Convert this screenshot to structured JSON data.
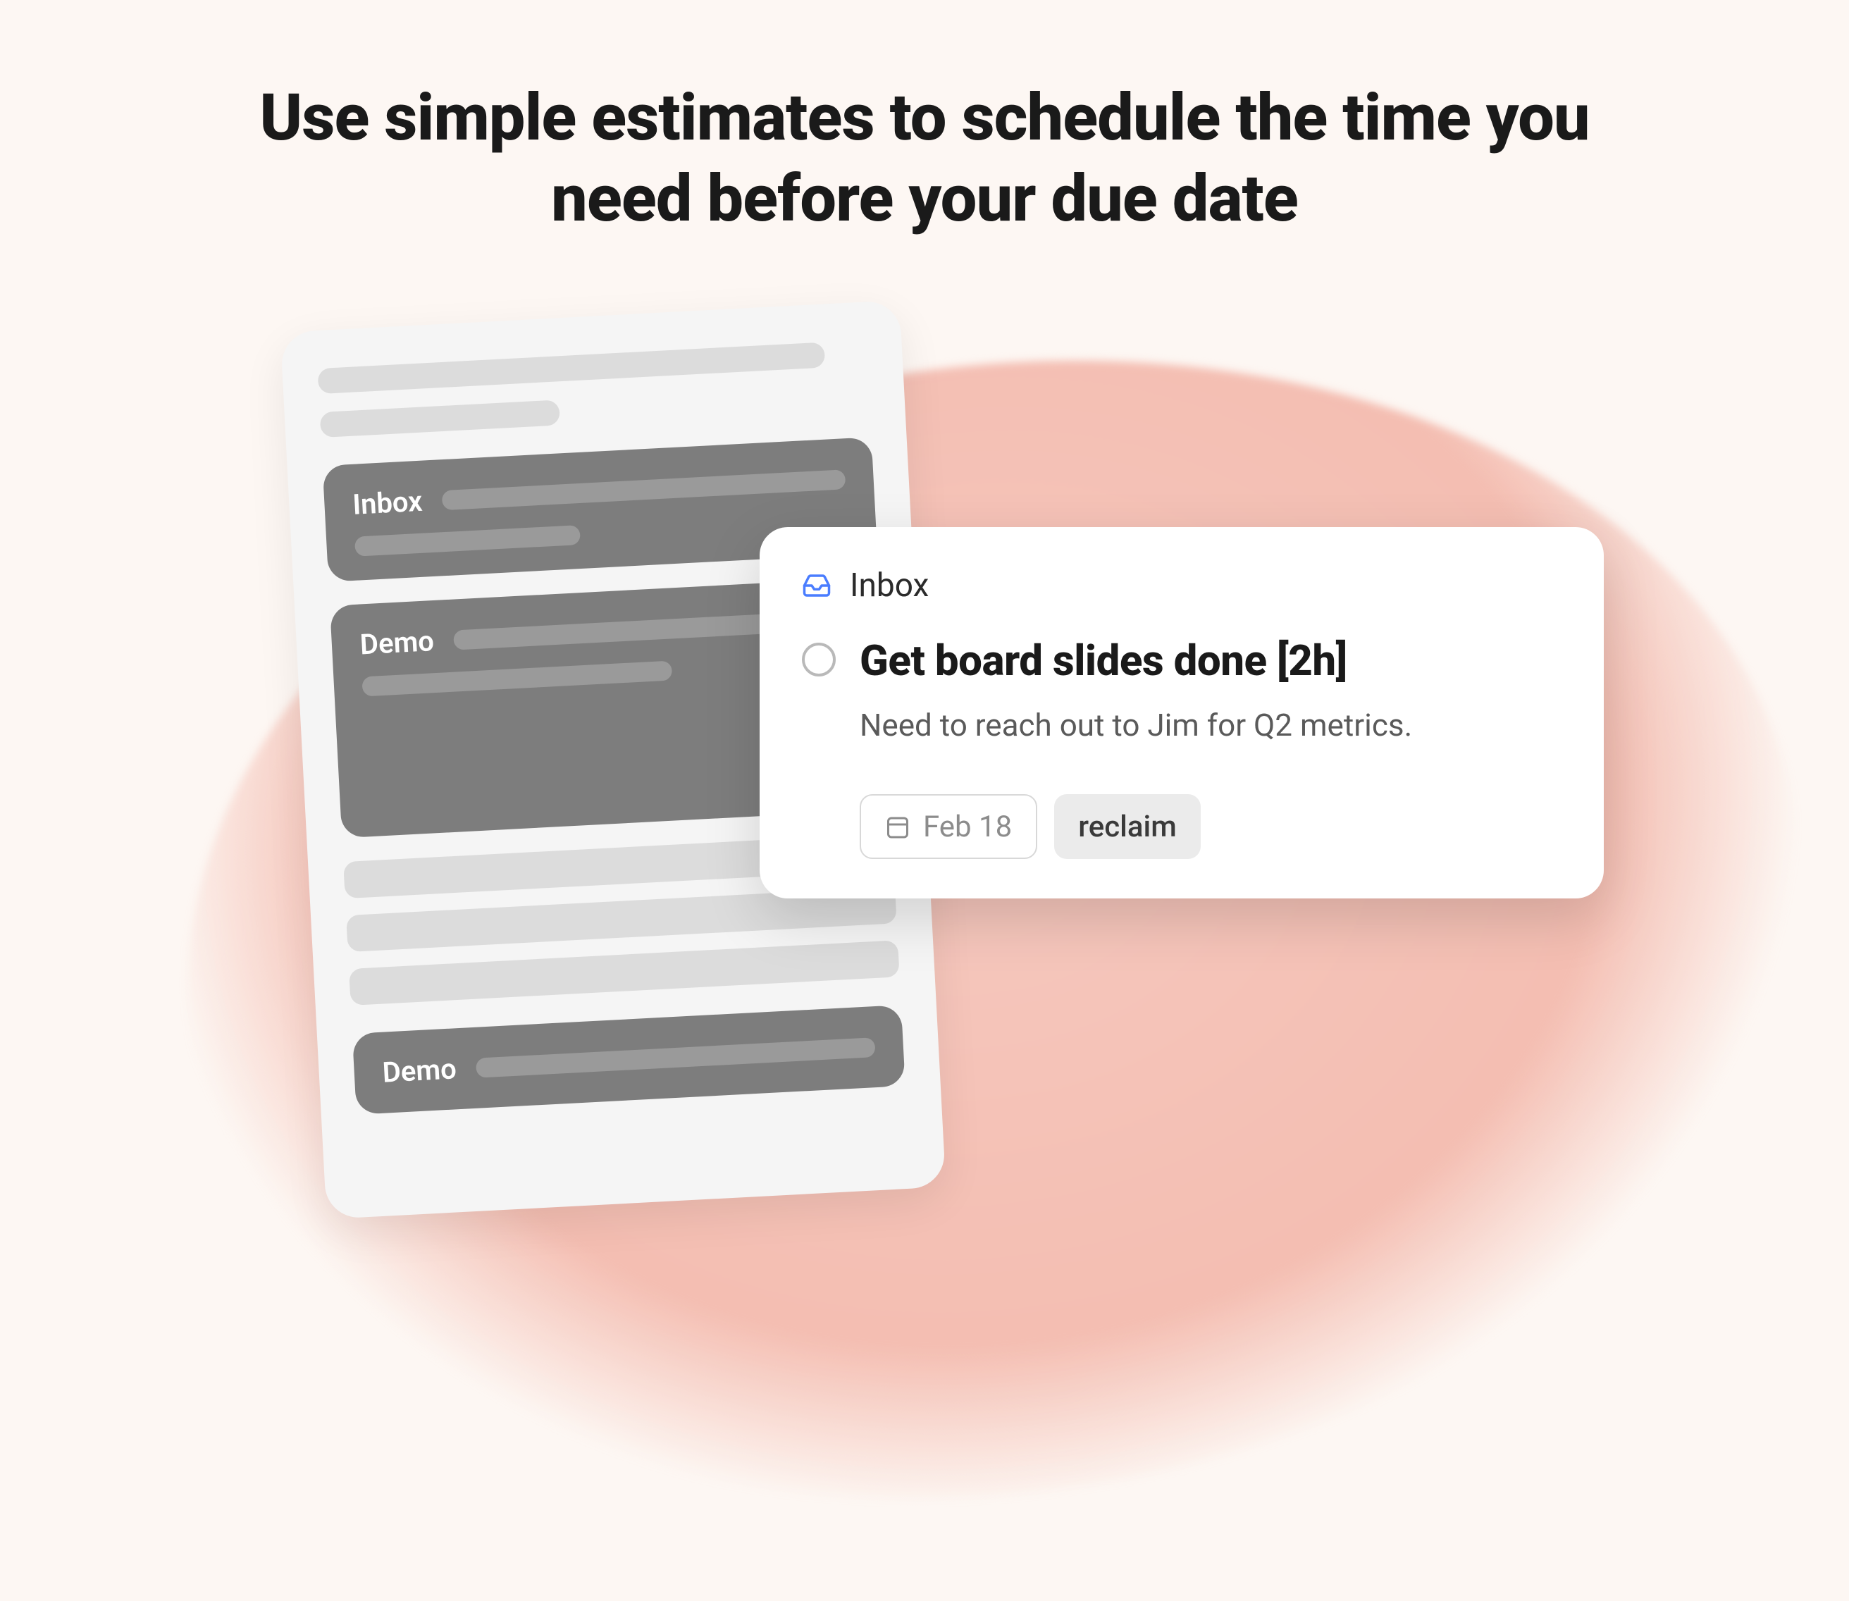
{
  "headline": "Use simple estimates to schedule the time you need before your due date",
  "skeleton": {
    "blocks": [
      {
        "label": "Inbox"
      },
      {
        "label": "Demo"
      },
      {
        "label": "Demo"
      }
    ]
  },
  "task": {
    "section": "Inbox",
    "title": "Get board slides done [2h]",
    "description": "Need to reach out to Jim for Q2 metrics.",
    "date": "Feb 18",
    "action": "reclaim"
  }
}
